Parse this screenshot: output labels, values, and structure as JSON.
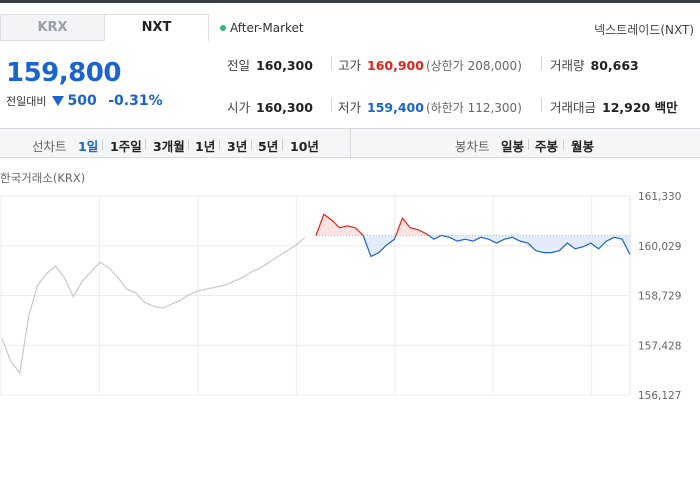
{
  "tabs": [
    {
      "label": "KRX",
      "active": false
    },
    {
      "label": "NXT",
      "active": true
    }
  ],
  "market_status": "After-Market",
  "exchange_name": "넥스트레이드(NXT)",
  "quote": {
    "price": "159,800",
    "change_label": "전일대비",
    "change_amount": "500",
    "change_percent": "-0.31%",
    "direction": "down"
  },
  "stats": {
    "prev_close": {
      "label": "전일",
      "value": "160,300"
    },
    "high": {
      "label": "고가",
      "value": "160,900",
      "sub": "(상한가 208,000)"
    },
    "volume": {
      "label": "거래량",
      "value": "80,663"
    },
    "open": {
      "label": "시가",
      "value": "160,300"
    },
    "low": {
      "label": "저가",
      "value": "159,400",
      "sub": "(하한가 112,300)"
    },
    "trade_value": {
      "label": "거래대금",
      "value": "12,920 백만"
    }
  },
  "toolbar": {
    "line_chart_label": "선차트",
    "line_periods": [
      "1일",
      "1주일",
      "3개월",
      "1년",
      "3년",
      "5년",
      "10년"
    ],
    "active_period": "1일",
    "candle_chart_label": "봉차트",
    "candle_periods": [
      "일봉",
      "주봉",
      "월봉"
    ]
  },
  "colors": {
    "up": "#e2231a",
    "down": "#1a63d0",
    "accent": "#2fb57d"
  },
  "chart_data": {
    "type": "line",
    "title": "한국거래소(KRX)",
    "y_ticks": [
      "161,330",
      "160,029",
      "158,729",
      "157,428",
      "156,127"
    ],
    "ylim": [
      156127,
      161330
    ],
    "reference_price": 160300,
    "grid": true,
    "series": [
      {
        "name": "",
        "values": [
          157600,
          157000,
          156700,
          158200,
          159000,
          159300,
          159500,
          159200,
          158700,
          159100,
          159350,
          159600,
          159450,
          159200,
          158900,
          158800,
          158550,
          158450,
          158400,
          158500,
          158600,
          158750,
          158850,
          158900,
          158950,
          159000,
          159100,
          159200,
          159350,
          159450,
          159600,
          159750,
          159900,
          160050,
          160250
        ],
        "color": "#c8c8c8"
      },
      {
        "name": "",
        "values": [
          160300,
          160850,
          160700,
          160500,
          160550,
          160500,
          160300,
          159750,
          159850,
          160050,
          160200,
          160750,
          160500,
          160450,
          160350,
          160200,
          160300,
          160250,
          160150,
          160200,
          160150,
          160250,
          160200,
          160100,
          160200,
          160250,
          160150,
          160100,
          159900,
          159850,
          159850,
          159900,
          160100,
          159950,
          160000,
          160100,
          159950,
          160150,
          160250,
          160200,
          159800
        ],
        "color": "#1a63d0"
      }
    ]
  }
}
